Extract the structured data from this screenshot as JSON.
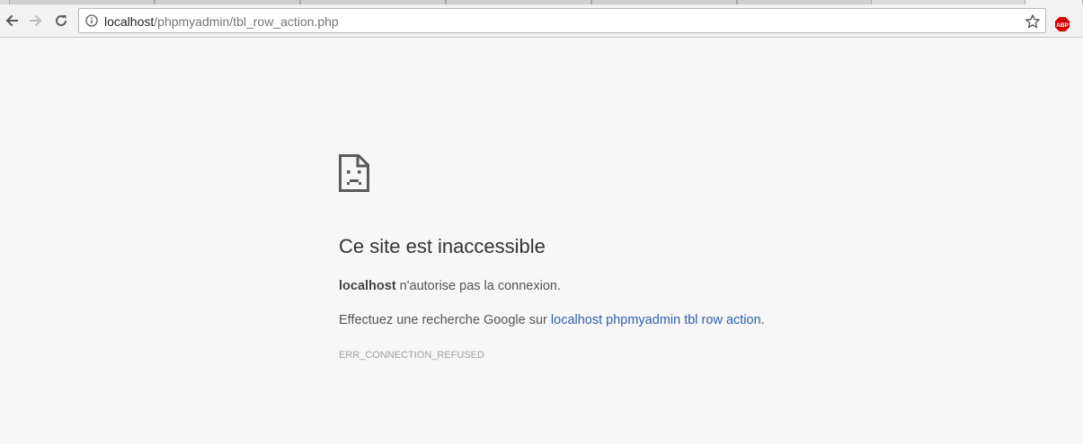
{
  "browser": {
    "omnibox": {
      "url_host": "localhost",
      "url_path": "/phpmyadmin/tbl_row_action.php"
    },
    "extension": {
      "label": "ABP",
      "color": "#d40000"
    }
  },
  "error_page": {
    "title": "Ce site est inaccessible",
    "host": "localhost",
    "message": " n'autorise pas la connexion.",
    "search_prefix": "Effectuez une recherche Google sur ",
    "search_link": "localhost phpmyadmin tbl row action",
    "search_suffix": ".",
    "error_code": "ERR_CONNECTION_REFUSED"
  }
}
